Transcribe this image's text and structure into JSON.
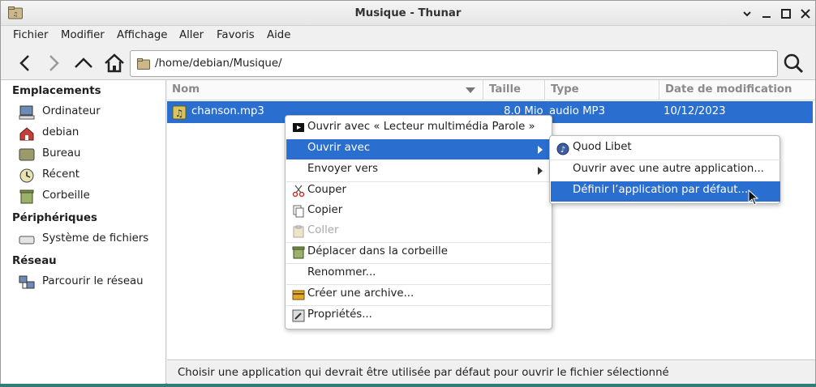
{
  "window": {
    "title": "Musique - Thunar"
  },
  "menubar": {
    "items": [
      "Fichier",
      "Modifier",
      "Affichage",
      "Aller",
      "Favoris",
      "Aide"
    ]
  },
  "toolbar": {
    "path": "/home/debian/Musique/"
  },
  "sidebar": {
    "sections": [
      {
        "title": "Emplacements",
        "items": [
          "Ordinateur",
          "debian",
          "Bureau",
          "Récent",
          "Corbeille"
        ]
      },
      {
        "title": "Périphériques",
        "items": [
          "Système de fichiers"
        ]
      },
      {
        "title": "Réseau",
        "items": [
          "Parcourir le réseau"
        ]
      }
    ]
  },
  "columns": [
    "Nom",
    "Taille",
    "Type",
    "Date de modification"
  ],
  "files": [
    {
      "name": "chanson.mp3",
      "size": "8.0 Mio",
      "type": "audio MP3",
      "date": "10/12/2023"
    }
  ],
  "context_menu": {
    "items": [
      "Ouvrir avec « Lecteur multimédia Parole »",
      "Ouvrir avec",
      "Envoyer vers",
      "Couper",
      "Copier",
      "Coller",
      "Déplacer dans la corbeille",
      "Renommer...",
      "Créer une archive...",
      "Propriétés..."
    ]
  },
  "submenu": {
    "items": [
      "Quod Libet",
      "Ouvrir avec une autre application...",
      "Définir l’application par défaut..."
    ]
  },
  "status": {
    "text": "Choisir une application qui devrait être utilisée par défaut pour ouvrir le fichier sélectionné"
  },
  "colors": {
    "selection": "#2a6fd0",
    "desktop": "#2f7f78"
  }
}
